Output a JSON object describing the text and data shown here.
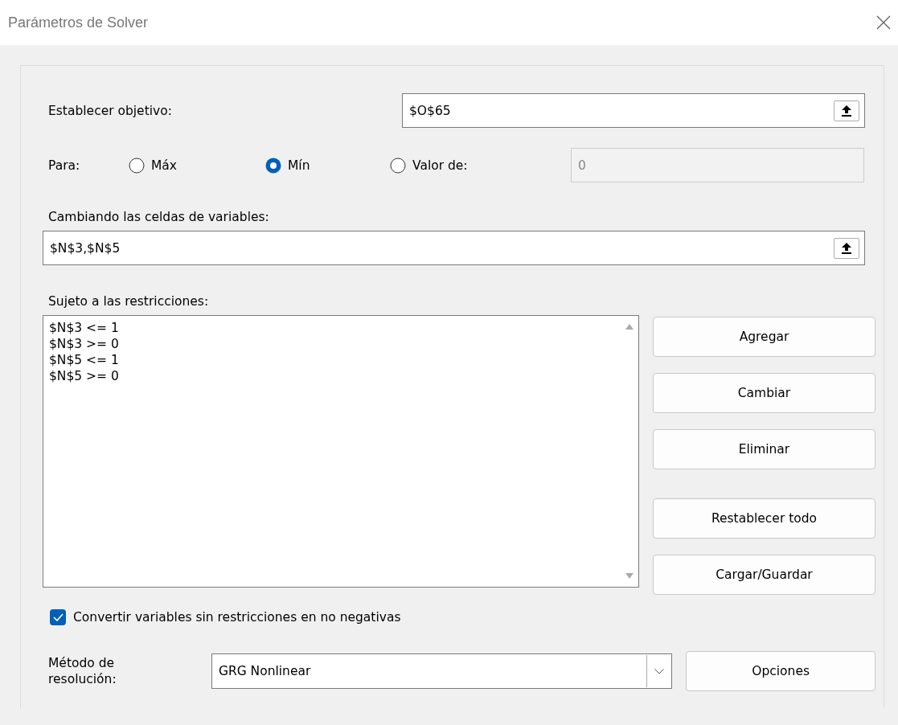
{
  "window": {
    "title": "Parámetros de Solver"
  },
  "objective": {
    "label": "Establecer objetivo:",
    "value": "$O$65"
  },
  "target": {
    "label": "Para:",
    "options": [
      {
        "label": "Máx",
        "selected": false
      },
      {
        "label": "Mín",
        "selected": true
      },
      {
        "label": "Valor de:",
        "selected": false
      }
    ],
    "value_field": {
      "value": "0",
      "disabled": true
    }
  },
  "variables": {
    "label": "Cambiando las celdas de variables:",
    "value": "$N$3,$N$5"
  },
  "constraints": {
    "label": "Sujeto a las restricciones:",
    "items": [
      "$N$3 <= 1",
      "$N$3 >= 0",
      "$N$5 <= 1",
      "$N$5 >= 0"
    ]
  },
  "edit_buttons": [
    "Agregar",
    "Cambiar",
    "Eliminar"
  ],
  "file_buttons": [
    "Restablecer todo",
    "Cargar/Guardar"
  ],
  "nonnegative": {
    "label": "Convertir variables sin restricciones en no negativas",
    "checked": true
  },
  "method": {
    "label": "Método de resolución:",
    "value": "GRG Nonlinear"
  },
  "options_button": "Opciones"
}
